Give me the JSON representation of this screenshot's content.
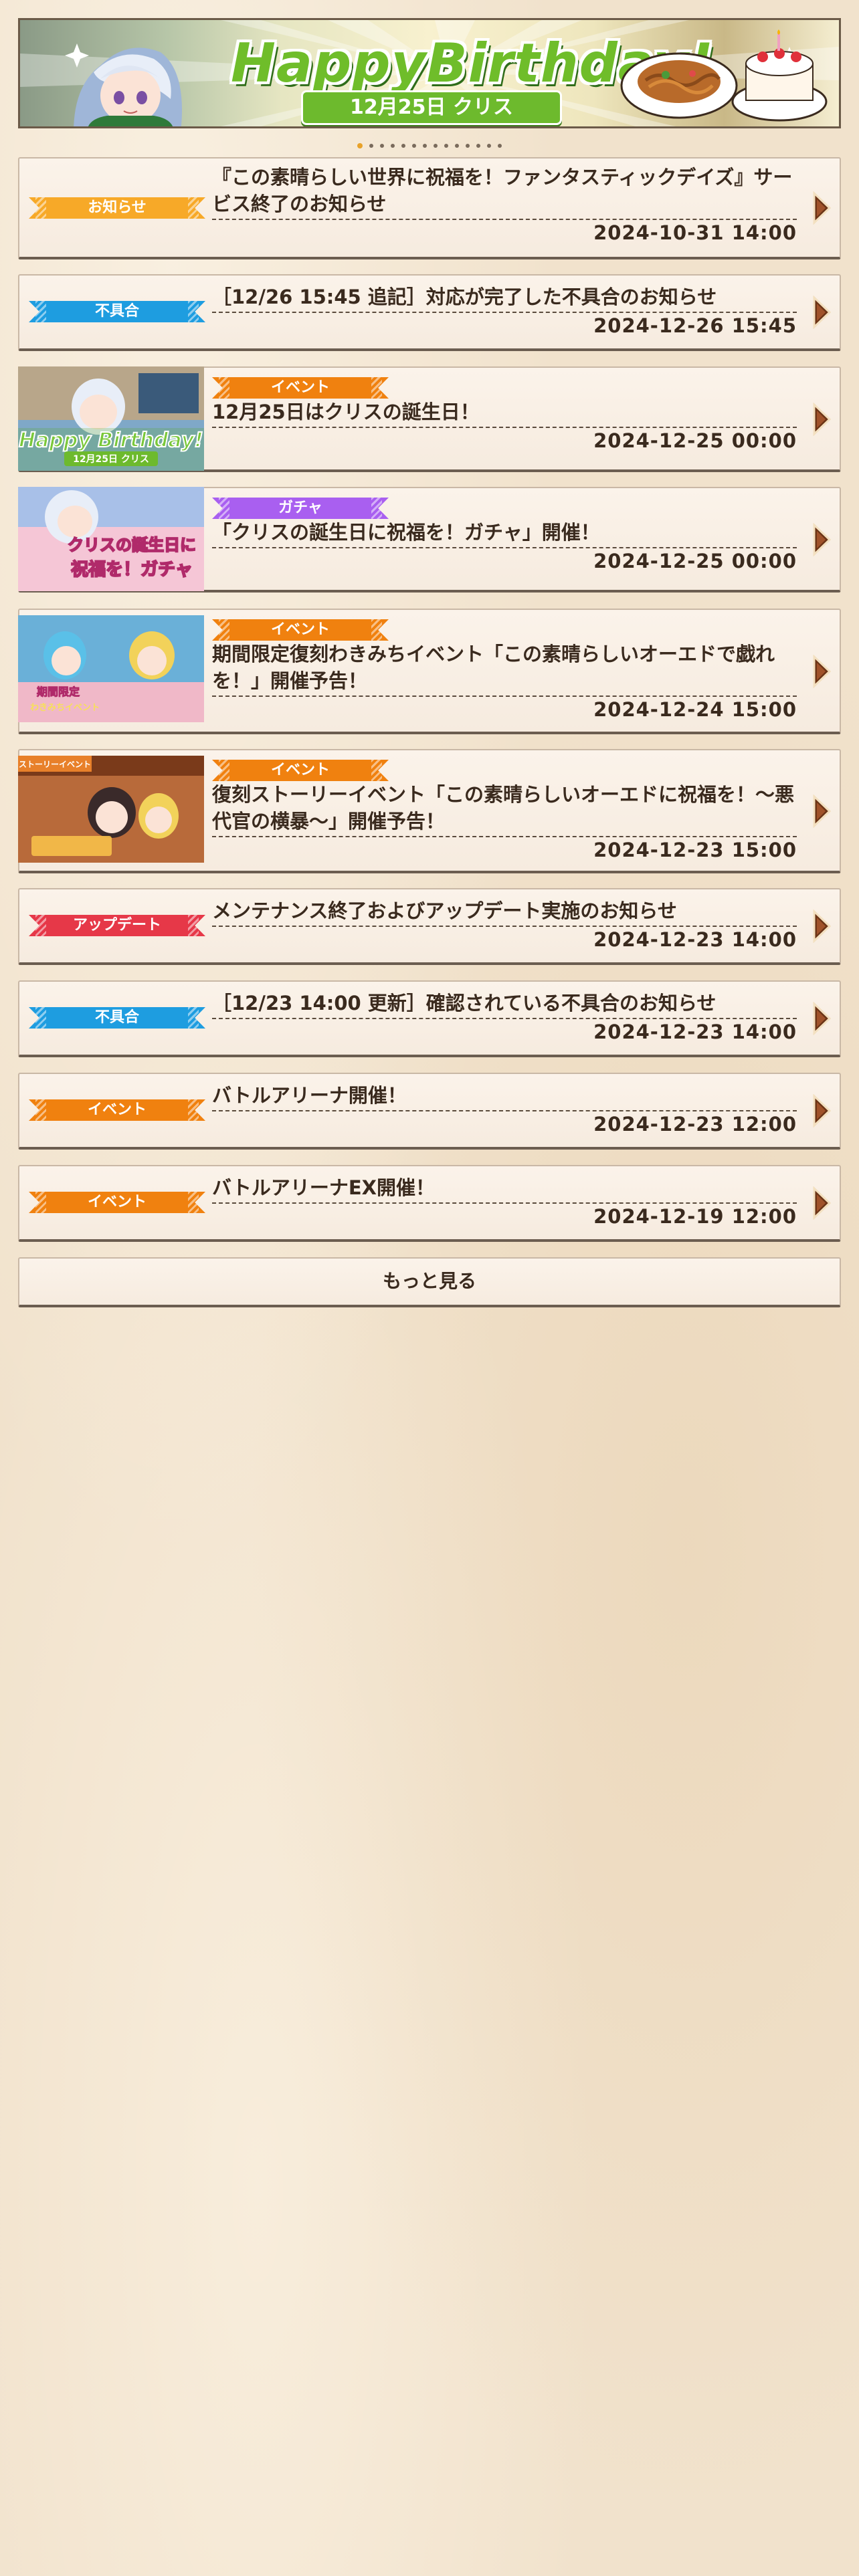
{
  "banner": {
    "title": "HappyBirthday!",
    "subtitle": "12月25日 クリス"
  },
  "carousel": {
    "total": 14,
    "active_index": 0
  },
  "news": [
    {
      "tag": "お知らせ",
      "tag_color": "#f7a928",
      "title": "『この素晴らしい世界に祝福を！ファンタスティックデイズ』サービス終了のお知らせ",
      "date": "2024-10-31 14:00"
    },
    {
      "tag": "不具合",
      "tag_color": "#1e9de0",
      "title": "［12/26 15:45 追記］対応が完了した不具合のお知らせ",
      "date": "2024-12-26 15:45"
    },
    {
      "tag": "イベント",
      "tag_color": "#f0810f",
      "title": "12月25日はクリスの誕生日！",
      "date": "2024-12-25 00:00",
      "thumb_text": "Happy Birthday!",
      "thumb_sub": "12月25日 クリス"
    },
    {
      "tag": "ガチャ",
      "tag_color": "#a95ff0",
      "title": "「クリスの誕生日に祝福を！ガチャ」開催！",
      "date": "2024-12-25 00:00",
      "thumb_text": "クリスの誕生日に",
      "thumb_sub": "祝福を！ガチャ"
    },
    {
      "tag": "イベント",
      "tag_color": "#f0810f",
      "title": "期間限定復刻わきみちイベント「この素晴らしいオーエドで戯れを！」開催予告！",
      "date": "2024-12-24 15:00",
      "thumb_text": "期間限定",
      "thumb_sub": "わきみちイベント"
    },
    {
      "tag": "イベント",
      "tag_color": "#f0810f",
      "title": "復刻ストーリーイベント「この素晴らしいオーエドに祝福を！〜悪代官の横暴〜」開催予告！",
      "date": "2024-12-23 15:00",
      "thumb_text": "ストーリーイベント",
      "thumb_sub": ""
    },
    {
      "tag": "アップデート",
      "tag_color": "#e63848",
      "title": "メンテナンス終了およびアップデート実施のお知らせ",
      "date": "2024-12-23 14:00"
    },
    {
      "tag": "不具合",
      "tag_color": "#1e9de0",
      "title": "［12/23 14:00 更新］確認されている不具合のお知らせ",
      "date": "2024-12-23 14:00"
    },
    {
      "tag": "イベント",
      "tag_color": "#f0810f",
      "title": "バトルアリーナ開催！",
      "date": "2024-12-23 12:00"
    },
    {
      "tag": "イベント",
      "tag_color": "#f0810f",
      "title": "バトルアリーナEX開催！",
      "date": "2024-12-19 12:00"
    }
  ],
  "more_button": "もっと見る",
  "icons": {
    "arrow": "chevron-right-icon"
  }
}
